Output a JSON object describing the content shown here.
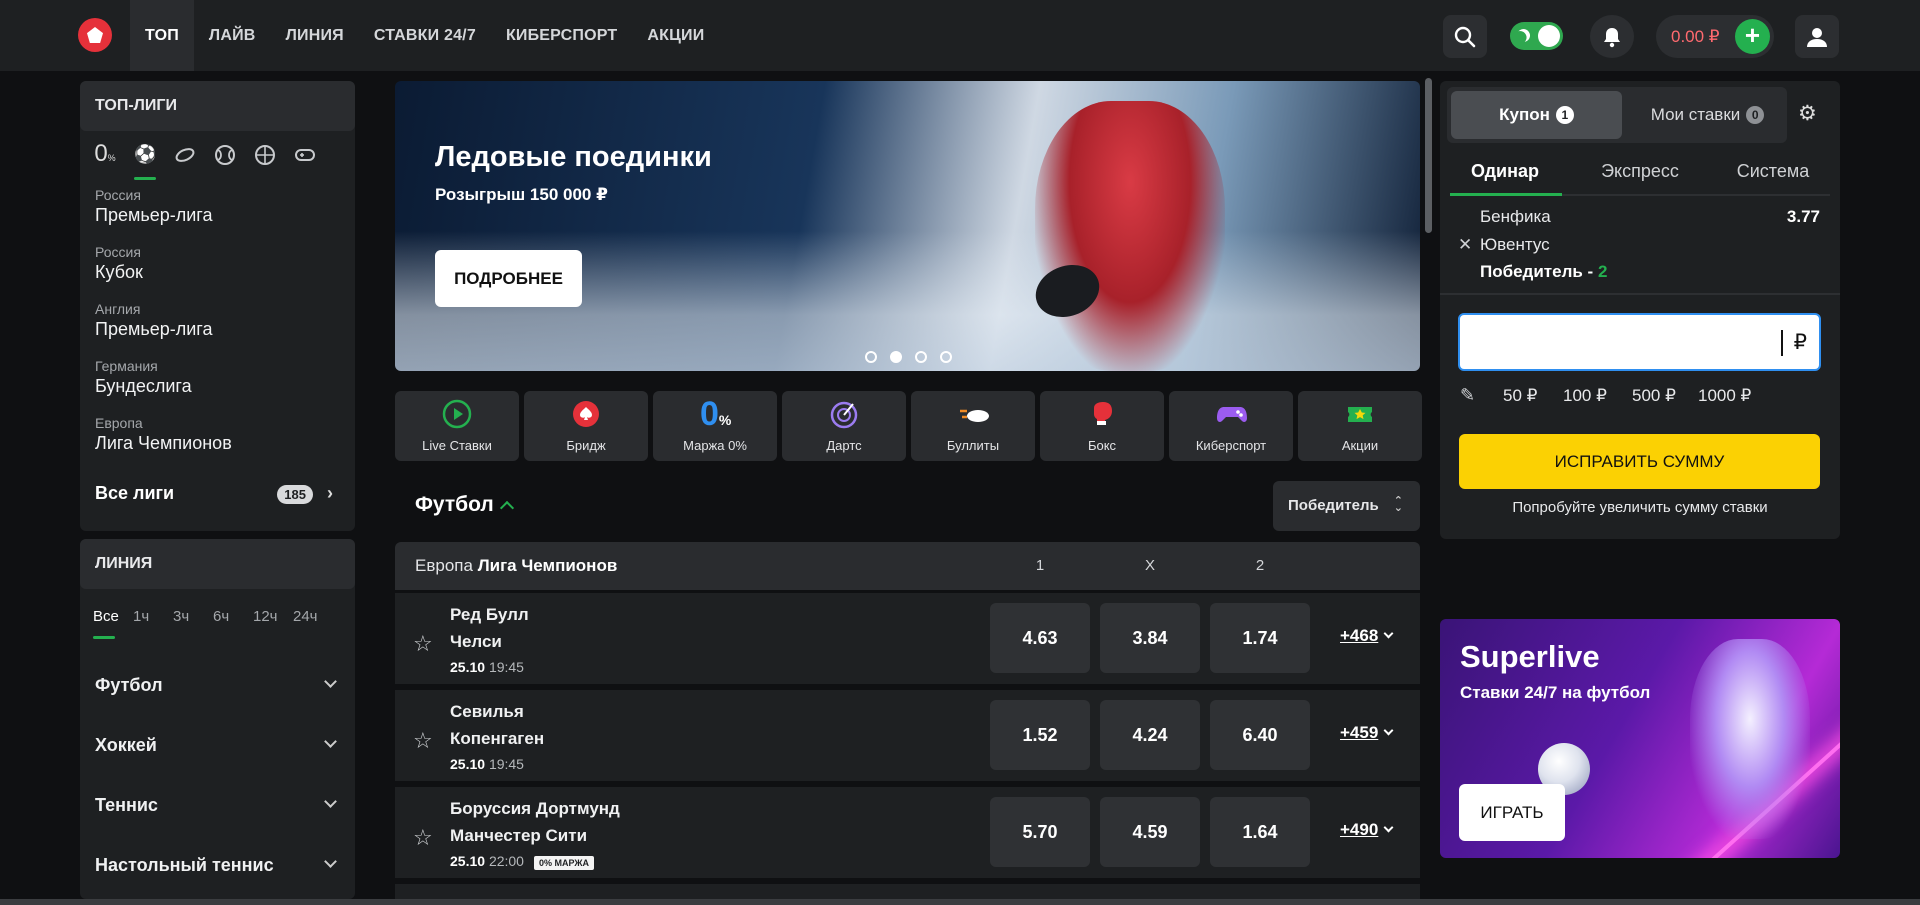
{
  "header": {
    "nav": [
      "ТОП",
      "ЛАЙВ",
      "ЛИНИЯ",
      "СТАВКИ 24/7",
      "КИБЕРСПОРТ",
      "АКЦИИ"
    ],
    "balance": "0.00 ₽",
    "plus": "+"
  },
  "sidebar": {
    "top_leagues_title": "ТОП-ЛИГИ",
    "margin_icon": "0",
    "leagues": [
      {
        "country": "Россия",
        "name": "Премьер-лига"
      },
      {
        "country": "Россия",
        "name": "Кубок"
      },
      {
        "country": "Англия",
        "name": "Премьер-лига"
      },
      {
        "country": "Германия",
        "name": "Бундеслига"
      },
      {
        "country": "Европа",
        "name": "Лига Чемпионов"
      }
    ],
    "all_leagues": "Все лиги",
    "all_leagues_count": "185",
    "line_title": "ЛИНИЯ",
    "time_filters": [
      "Все",
      "1ч",
      "3ч",
      "6ч",
      "12ч",
      "24ч"
    ],
    "sports": [
      "Футбол",
      "Хоккей",
      "Теннис",
      "Настольный теннис"
    ]
  },
  "banner": {
    "title": "Ледовые поединки",
    "subtitle": "Розыгрыш 150 000 ₽",
    "button": "ПОДРОБНЕЕ"
  },
  "tiles": [
    {
      "label": "Live Ставки",
      "icon": "play-icon",
      "color": "#24b04f"
    },
    {
      "label": "Бридж",
      "icon": "spade-icon",
      "color": "#e5313a"
    },
    {
      "label": "Маржа 0%",
      "icon": "zero-percent-icon",
      "color": "#2f8ff0"
    },
    {
      "label": "Дартс",
      "icon": "dart-icon",
      "color": "#9b7cf0"
    },
    {
      "label": "Буллиты",
      "icon": "puck-icon",
      "color": "#f08a24"
    },
    {
      "label": "Бокс",
      "icon": "boxing-glove-icon",
      "color": "#e5313a"
    },
    {
      "label": "Киберспорт",
      "icon": "gamepad-icon",
      "color": "#9b5cf0"
    },
    {
      "label": "Акции",
      "icon": "ticket-icon",
      "color": "#24b04f"
    }
  ],
  "section": {
    "title": "Футбол",
    "market_select": "Победитель",
    "league_region": "Европа",
    "league_name": "Лига Чемпионов",
    "cols": [
      "1",
      "X",
      "2"
    ]
  },
  "matches": [
    {
      "home": "Ред Булл",
      "away": "Челси",
      "date": "25.10",
      "time": "19:45",
      "odds": [
        "4.63",
        "3.84",
        "1.74"
      ],
      "more": "+468",
      "badge": ""
    },
    {
      "home": "Севилья",
      "away": "Копенгаген",
      "date": "25.10",
      "time": "19:45",
      "odds": [
        "1.52",
        "4.24",
        "6.40"
      ],
      "more": "+459",
      "badge": ""
    },
    {
      "home": "Боруссия Дортмунд",
      "away": "Манчестер Сити",
      "date": "25.10",
      "time": "22:00",
      "odds": [
        "5.70",
        "4.59",
        "1.64"
      ],
      "more": "+490",
      "badge": "0% МАРЖА"
    }
  ],
  "coupon": {
    "tab_coupon": "Купон",
    "tab_coupon_count": "1",
    "tab_mybets": "Мои ставки",
    "tab_mybets_count": "0",
    "bet_types": [
      "Одинар",
      "Экспресс",
      "Система"
    ],
    "bet": {
      "home": "Бенфика",
      "away": "Ювентус",
      "market": "Победитель - ",
      "outcome": "2",
      "coef": "3.77"
    },
    "currency": "₽",
    "amount_value": "",
    "quick_amounts": [
      "50 ₽",
      "100 ₽",
      "500 ₽",
      "1000 ₽"
    ],
    "fix_button": "ИСПРАВИТЬ СУММУ",
    "hint": "Попробуйте увеличить сумму ставки"
  },
  "promo": {
    "title": "Superlive",
    "subtitle": "Ставки 24/7 на футбол",
    "button": "ИГРАТЬ"
  },
  "colors": {
    "accent_green": "#24b04f",
    "accent_yellow": "#fbd103",
    "brand_red": "#e5313a",
    "balance_red": "#ff6a6f"
  }
}
